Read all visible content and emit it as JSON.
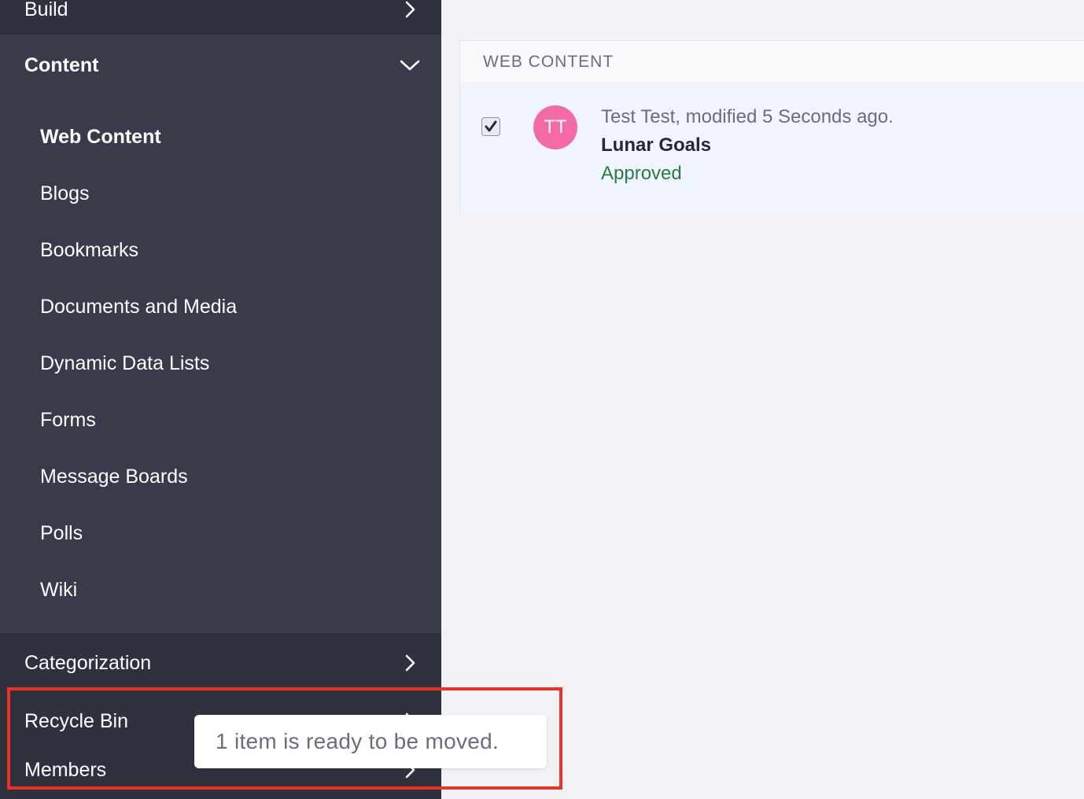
{
  "sidebar": {
    "build_label": "Build",
    "content_label": "Content",
    "content_items": [
      {
        "label": "Web Content",
        "active": true
      },
      {
        "label": "Blogs"
      },
      {
        "label": "Bookmarks"
      },
      {
        "label": "Documents and Media"
      },
      {
        "label": "Dynamic Data Lists"
      },
      {
        "label": "Forms"
      },
      {
        "label": "Message Boards"
      },
      {
        "label": "Polls"
      },
      {
        "label": "Wiki"
      }
    ],
    "categorization_label": "Categorization",
    "recycle_bin_label": "Recycle Bin",
    "members_label": "Members"
  },
  "main": {
    "card_header": "WEB CONTENT",
    "entry": {
      "avatar_initials": "TT",
      "meta": "Test Test, modified 5 Seconds ago.",
      "title": "Lunar Goals",
      "status": "Approved",
      "checked": true
    }
  },
  "toast": {
    "message": "1 item is ready to be moved."
  },
  "colors": {
    "sidebar_bg": "#30313f",
    "content_panel_bg": "#393a4a",
    "avatar_bg": "#f36aa4",
    "status_approved": "#287d3c",
    "highlight": "#ea3323"
  },
  "icons": {
    "chevron_right": "chevron-right-icon",
    "chevron_down": "chevron-down-icon",
    "check": "check-icon"
  }
}
